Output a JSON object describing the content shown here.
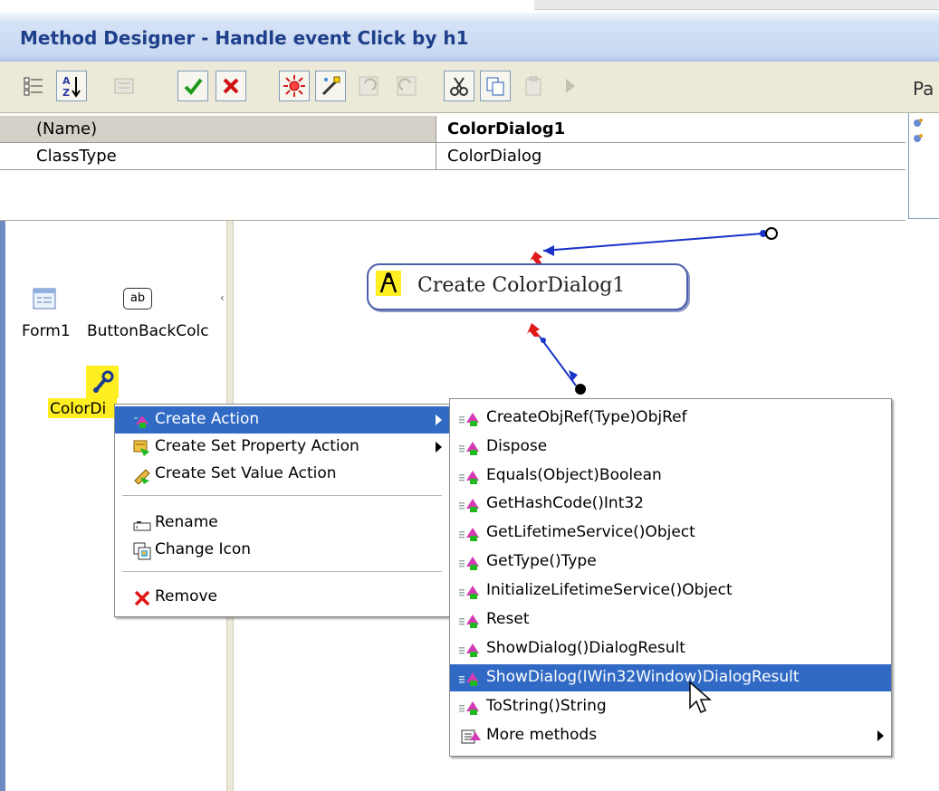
{
  "window": {
    "title": "Method Designer - Handle event Click by h1"
  },
  "toolbar": {
    "pa_label": "Pa"
  },
  "properties": {
    "rows": [
      {
        "name": "(Name)",
        "value": "ColorDialog1"
      },
      {
        "name": "ClassType",
        "value": "ColorDialog"
      }
    ]
  },
  "components": {
    "form1": "Form1",
    "button": "ButtonBackColc",
    "button_icon_text": "ab",
    "colordialog": "ColorDi"
  },
  "canvas": {
    "action_node_label": "Create ColorDialog1"
  },
  "context_menu": {
    "items": [
      {
        "label": "Create Action",
        "icon": "action-icon",
        "submenu": true,
        "selected": true
      },
      {
        "label": "Create Set Property Action",
        "icon": "property-icon",
        "submenu": true
      },
      {
        "label": "Create Set Value Action",
        "icon": "set-value-icon"
      },
      {
        "label": "Rename",
        "icon": "rename-icon"
      },
      {
        "label": "Change Icon",
        "icon": "change-icon-icon"
      },
      {
        "label": "Remove",
        "icon": "remove-x-icon"
      }
    ]
  },
  "submenu": {
    "items": [
      {
        "label": "CreateObjRef(Type)ObjRef"
      },
      {
        "label": "Dispose"
      },
      {
        "label": "Equals(Object)Boolean"
      },
      {
        "label": "GetHashCode()Int32"
      },
      {
        "label": "GetLifetimeService()Object"
      },
      {
        "label": "GetType()Type"
      },
      {
        "label": "InitializeLifetimeService()Object"
      },
      {
        "label": "Reset"
      },
      {
        "label": "ShowDialog()DialogResult"
      },
      {
        "label": "ShowDialog(IWin32Window)DialogResult",
        "selected": true
      },
      {
        "label": "ToString()String"
      },
      {
        "label": "More methods",
        "submenu": true
      }
    ]
  },
  "colors": {
    "menu_highlight": "#316ac5",
    "title_text": "#1e3f8a",
    "selection_yellow": "#ffee22"
  }
}
